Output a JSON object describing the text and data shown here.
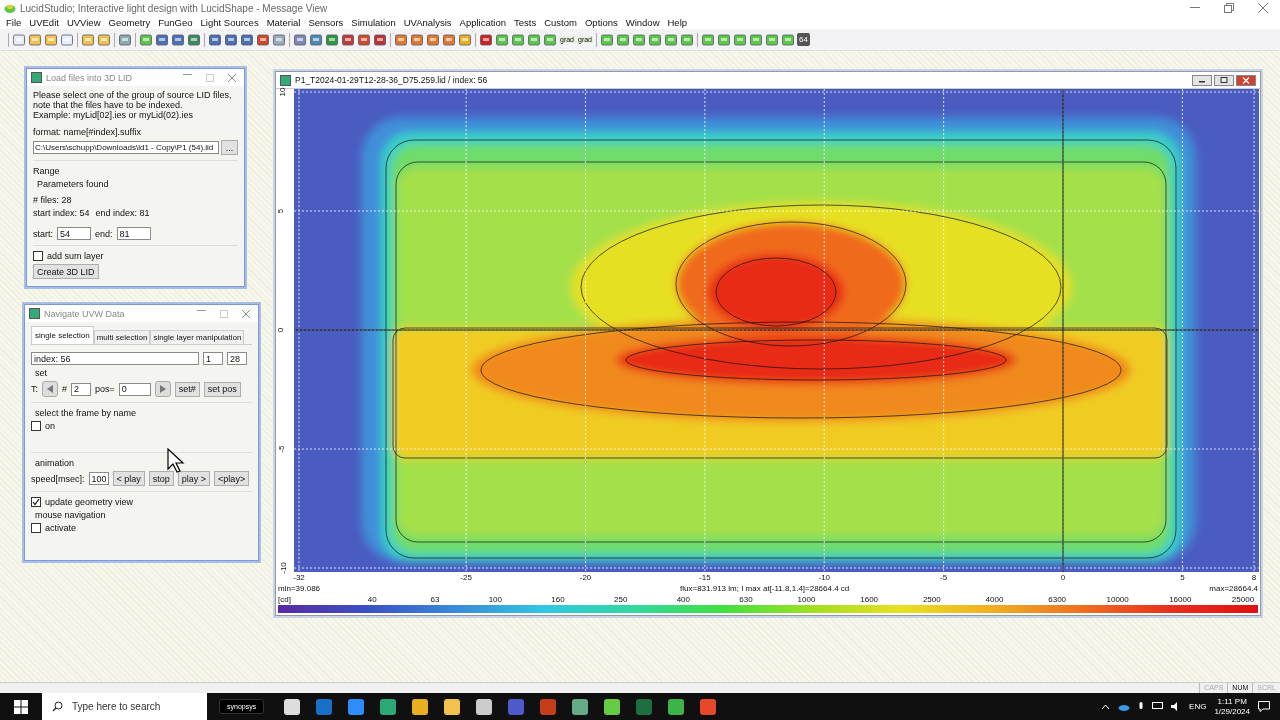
{
  "app_window": {
    "title": "LucidStudio; Interactive light design with LucidShape - Message View"
  },
  "menu": [
    "File",
    "UVEdit",
    "UVView",
    "Geometry",
    "FunGeo",
    "Light Sources",
    "Material",
    "Sensors",
    "Simulation",
    "UVAnalysis",
    "Application",
    "Tests",
    "Custom",
    "Options",
    "Window",
    "Help"
  ],
  "toolbar": {
    "grad_labels": [
      "grad",
      "grad"
    ],
    "bits_badge": "64"
  },
  "load_dialog": {
    "title": "Load files into 3D LID",
    "intro": "Please select one of the group of source LID files,\nnote that the files have to be indexed.\nExample: myLid[02].ies or myLid(02).ies",
    "format_label": "format: name[#index].suffix",
    "path": "C:\\Users\\schupp\\Downloads\\ld1 - Copy\\P1 (54).lid",
    "browse_button": "...",
    "range_title": "Range",
    "params_found": "Parameters found",
    "files": "# files: 28",
    "start_index": "start index: 54",
    "end_index": "end index: 81",
    "start_label": "start:",
    "start_value": "54",
    "end_label": "end:",
    "end_value": "81",
    "add_sum_layer": {
      "label": "add sum layer",
      "checked": false
    },
    "create_button": "Create 3D LID"
  },
  "navigate_dialog": {
    "title": "Navigate UVW Data",
    "tabs": [
      {
        "label": "single selection",
        "selected": true
      },
      {
        "label": "multi selection",
        "selected": false
      },
      {
        "label": "single layer manipulation",
        "selected": false
      }
    ],
    "index_field": "index: 56",
    "index_min": "1",
    "index_max": "28",
    "set_title": "set",
    "t_label": "T:",
    "hash_label": "#",
    "frame_value": "2",
    "pos_label": "pos=",
    "pos_value": "0",
    "set_frame_button": "set#",
    "set_pos_button": "set pos",
    "by_name_title": "select the frame by name",
    "by_name": {
      "label": "on",
      "checked": false
    },
    "animation_title": "animation",
    "speed_label": "speed[msec]:",
    "speed_value": "100",
    "anim_buttons": [
      "< play",
      "stop",
      "play >",
      "<play>"
    ],
    "update_geometry": {
      "label": "update geometry view",
      "checked": true
    },
    "mouse_nav_title": "mouse navigation",
    "mouse_nav": {
      "label": "activate",
      "checked": false
    }
  },
  "plot_window": {
    "title": "P1_T2024-01-29T12-28-36_D75.259.lid / index: 56",
    "y_ticks": [
      "10",
      "5",
      "0",
      "-5",
      "-10"
    ],
    "x_ticks": [
      "-32",
      "-25",
      "-20",
      "-15",
      "-10",
      "-5",
      "0",
      "5",
      "8"
    ],
    "min": "min=39.086",
    "info": "flux=831.913 lm; I max at[-11.8,1.4]=28664.4 cd",
    "max": "max=28664.4",
    "unit": "[cd]",
    "scale": [
      "40",
      "63",
      "100",
      "160",
      "250",
      "400",
      "630",
      "1000",
      "1600",
      "2500",
      "4000",
      "6300",
      "10000",
      "16000",
      "25000"
    ]
  },
  "status_bar": {
    "keys": [
      {
        "label": "CAPS",
        "on": false
      },
      {
        "label": "NUM",
        "on": true
      },
      {
        "label": "SCRL",
        "on": false
      }
    ]
  },
  "taskbar": {
    "search_placeholder": "Type here to search",
    "pinned_badge": "synopsys",
    "language": "ENG",
    "time": "1:11 PM",
    "date": "1/29/2024"
  }
}
